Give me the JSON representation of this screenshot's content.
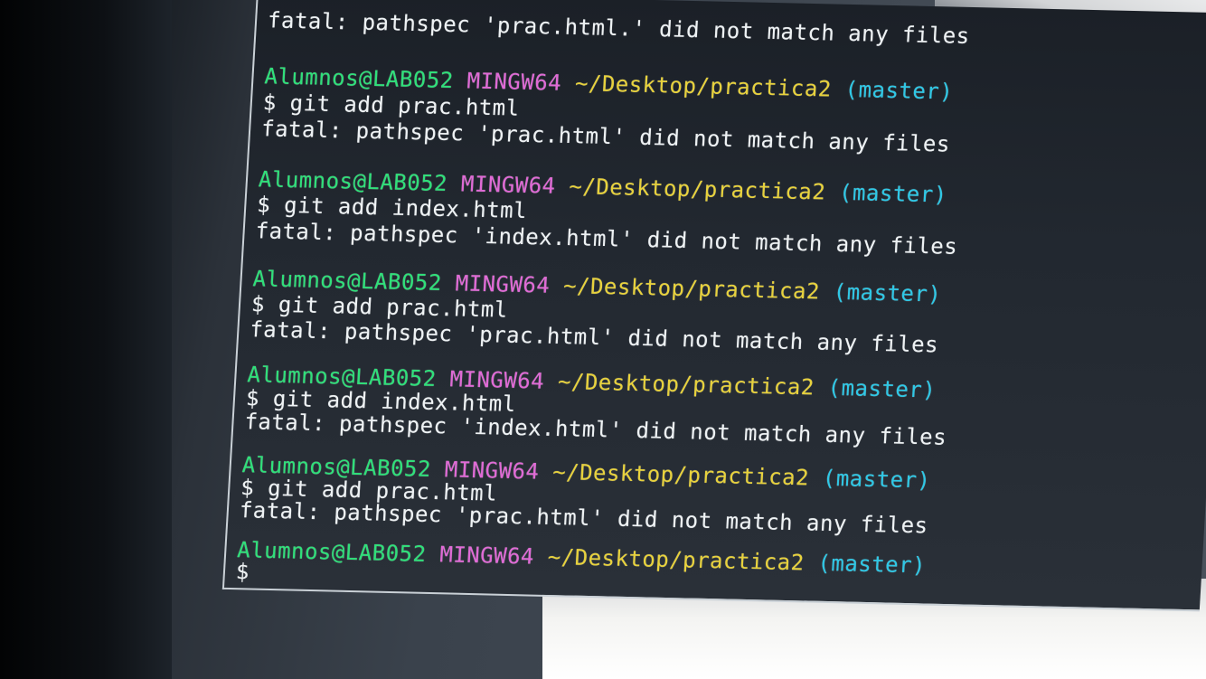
{
  "terminal": {
    "top_fragment": "fatal: pathspec 'prac.html.' did not match any files",
    "prompt": {
      "user": "Alumnos@LAB052",
      "host": "MINGW64",
      "path": "~/Desktop/practica2",
      "branch": "(master)"
    },
    "blocks": [
      {
        "command": "$ git add prac.html",
        "output": "fatal: pathspec 'prac.html' did not match any files"
      },
      {
        "command": "$ git add index.html",
        "output": "fatal: pathspec 'index.html' did not match any files"
      },
      {
        "command": "$ git add prac.html",
        "output": "fatal: pathspec 'prac.html' did not match any files"
      },
      {
        "command": "$ git add index.html",
        "output": "fatal: pathspec 'index.html' did not match any files"
      },
      {
        "command": "$ git add prac.html",
        "output": "fatal: pathspec 'prac.html' did not match any files"
      }
    ],
    "final_prompt_symbol": "$"
  },
  "colors": {
    "user": "#2fe07a",
    "host": "#e06ad6",
    "path": "#e8d23c",
    "branch": "#2ec8e6",
    "text": "#eef2f4",
    "background": "#1f252c"
  }
}
